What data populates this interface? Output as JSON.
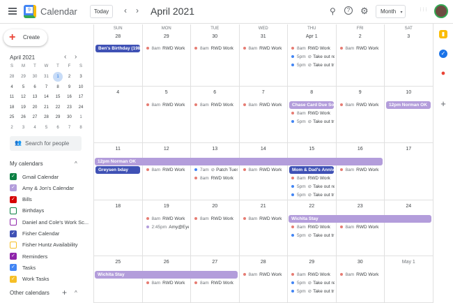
{
  "header": {
    "app_title": "Calendar",
    "logo_day": "9",
    "today": "Today",
    "prev": "‹",
    "next": "›",
    "month_title": "April 2021",
    "view": "Month",
    "view_caret": "▾",
    "search_icon": "⚲",
    "help_icon": "?",
    "settings_icon": "⚙",
    "apps_icon": "⋮⋮⋮"
  },
  "sidebar": {
    "create": "Create",
    "mini": {
      "title": "April 2021",
      "prev": "‹",
      "next": "›",
      "weekdays": [
        "S",
        "M",
        "T",
        "W",
        "T",
        "F",
        "S"
      ],
      "days": [
        "28",
        "29",
        "30",
        "31",
        "1",
        "2",
        "3",
        "4",
        "5",
        "6",
        "7",
        "8",
        "9",
        "10",
        "11",
        "12",
        "13",
        "14",
        "15",
        "16",
        "17",
        "18",
        "19",
        "20",
        "21",
        "22",
        "23",
        "24",
        "25",
        "26",
        "27",
        "28",
        "29",
        "30",
        "1",
        "2",
        "3",
        "4",
        "5",
        "6",
        "7",
        "8"
      ],
      "muted": [
        0,
        1,
        2,
        3,
        34,
        35,
        36,
        37,
        38,
        39,
        40,
        41
      ],
      "selected": 4
    },
    "search_placeholder": "Search for people",
    "my_calendars_label": "My calendars",
    "collapse": "^",
    "calendars": [
      {
        "name": "Gmail Calendar",
        "color": "#0b8043",
        "checked": true
      },
      {
        "name": "Amy & Jon's Calendar",
        "color": "#b39ddb",
        "checked": true
      },
      {
        "name": "Bills",
        "color": "#d50000",
        "checked": true
      },
      {
        "name": "Birthdays",
        "color": "#0b8043",
        "checked": false
      },
      {
        "name": "Daniel and Cole's Work Sc...",
        "color": "#8e24aa",
        "checked": false
      },
      {
        "name": "Fisher Calendar",
        "color": "#3f51b5",
        "checked": true
      },
      {
        "name": "Fisher Huntz Availability",
        "color": "#f6bf26",
        "checked": false
      },
      {
        "name": "Reminders",
        "color": "#8e24aa",
        "checked": true
      },
      {
        "name": "Tasks",
        "color": "#4285f4",
        "checked": true
      },
      {
        "name": "Work Tasks",
        "color": "#f6bf26",
        "checked": true
      }
    ],
    "other_calendars_label": "Other calendars",
    "add": "+"
  },
  "colors": {
    "rwd": "#e67c73",
    "task": "#4285f4",
    "dark": "#3f51b5",
    "lav": "#b39ddb",
    "amy": "#b39ddb"
  },
  "weekdays": [
    "SUN",
    "MON",
    "TUE",
    "WED",
    "THU",
    "FRI",
    "SAT"
  ],
  "weeks": [
    {
      "days": [
        {
          "n": "28",
          "ev": [
            {
              "chip": "dark",
              "title": "Ben's Birthday (1981"
            }
          ]
        },
        {
          "n": "29",
          "ev": [
            {
              "dot": "rwd",
              "time": "8am",
              "title": "RWD Work"
            }
          ]
        },
        {
          "n": "30",
          "ev": [
            {
              "dot": "rwd",
              "time": "8am",
              "title": "RWD Work"
            }
          ]
        },
        {
          "n": "31",
          "ev": [
            {
              "dot": "rwd",
              "time": "8am",
              "title": "RWD Work"
            }
          ]
        },
        {
          "n": "Apr 1",
          "ev": [
            {
              "dot": "rwd",
              "time": "8am",
              "title": "RWD Work"
            },
            {
              "dot": "task",
              "time": "5pm",
              "task": true,
              "title": "Take out re"
            },
            {
              "dot": "task",
              "time": "5pm",
              "task": true,
              "title": "Take out tr"
            }
          ]
        },
        {
          "n": "2",
          "ev": [
            {
              "dot": "rwd",
              "time": "8am",
              "title": "RWD Work"
            }
          ]
        },
        {
          "n": "3",
          "ev": []
        }
      ],
      "spans": []
    },
    {
      "days": [
        {
          "n": "4",
          "ev": []
        },
        {
          "n": "5",
          "ev": [
            {
              "dot": "rwd",
              "time": "8am",
              "title": "RWD Work"
            }
          ]
        },
        {
          "n": "6",
          "ev": [
            {
              "dot": "rwd",
              "time": "8am",
              "title": "RWD Work"
            }
          ]
        },
        {
          "n": "7",
          "ev": [
            {
              "dot": "rwd",
              "time": "8am",
              "title": "RWD Work"
            }
          ]
        },
        {
          "n": "8",
          "ev": [
            {
              "chip": "lav",
              "title": "Chase Card Due Soo"
            },
            {
              "dot": "rwd",
              "time": "8am",
              "title": "RWD Work"
            },
            {
              "dot": "task",
              "time": "5pm",
              "task": true,
              "title": "Take out tr"
            }
          ]
        },
        {
          "n": "9",
          "ev": [
            {
              "dot": "rwd",
              "time": "8am",
              "title": "RWD Work"
            }
          ]
        },
        {
          "n": "10",
          "ev": [
            {
              "chip": "lav",
              "title": "12pm Norman OK"
            }
          ]
        }
      ],
      "spans": []
    },
    {
      "days": [
        {
          "n": "11",
          "ev": [
            {
              "chip": "dark",
              "title": "Greysen bday"
            }
          ]
        },
        {
          "n": "12",
          "ev": [
            {
              "dot": "rwd",
              "time": "8am",
              "title": "RWD Work"
            }
          ]
        },
        {
          "n": "13",
          "ev": [
            {
              "dot": "task",
              "time": "7am",
              "task": true,
              "title": "Patch Tues"
            },
            {
              "dot": "rwd",
              "time": "8am",
              "title": "RWD Work"
            }
          ]
        },
        {
          "n": "14",
          "ev": [
            {
              "dot": "rwd",
              "time": "8am",
              "title": "RWD Work"
            }
          ]
        },
        {
          "n": "15",
          "ev": [
            {
              "chip": "dark",
              "title": "Mom & Dad's Annive"
            },
            {
              "dot": "rwd",
              "time": "8am",
              "title": "RWD Work"
            },
            {
              "dot": "task",
              "time": "5pm",
              "task": true,
              "title": "Take out re"
            },
            {
              "dot": "task",
              "time": "5pm",
              "task": true,
              "title": "Take out tr"
            }
          ]
        },
        {
          "n": "16",
          "ev": [
            {
              "dot": "rwd",
              "time": "8am",
              "title": "RWD Work"
            }
          ]
        },
        {
          "n": "17",
          "ev": []
        }
      ],
      "spans": [
        {
          "title": "12pm Norman OK",
          "color": "lav",
          "from": 0,
          "to": 5
        }
      ]
    },
    {
      "days": [
        {
          "n": "18",
          "ev": []
        },
        {
          "n": "19",
          "ev": [
            {
              "dot": "rwd",
              "time": "8am",
              "title": "RWD Work"
            },
            {
              "dot": "amy",
              "time": "2:45pm",
              "title": "Amy@EyeD"
            }
          ]
        },
        {
          "n": "20",
          "ev": [
            {
              "dot": "rwd",
              "time": "8am",
              "title": "RWD Work"
            }
          ]
        },
        {
          "n": "21",
          "ev": [
            {
              "dot": "rwd",
              "time": "8am",
              "title": "RWD Work"
            }
          ]
        },
        {
          "n": "22",
          "ev": [
            {
              "dot": "rwd",
              "time": "8am",
              "title": "RWD Work"
            },
            {
              "dot": "task",
              "time": "5pm",
              "task": true,
              "title": "Take out tr"
            }
          ]
        },
        {
          "n": "23",
          "ev": [
            {
              "dot": "rwd",
              "time": "8am",
              "title": "RWD Work"
            }
          ]
        },
        {
          "n": "24",
          "ev": []
        }
      ],
      "spans": [
        {
          "title": "Wichita Stay",
          "color": "lav",
          "from": 4,
          "to": 6
        }
      ]
    },
    {
      "days": [
        {
          "n": "25",
          "ev": []
        },
        {
          "n": "26",
          "ev": [
            {
              "dot": "rwd",
              "time": "8am",
              "title": "RWD Work"
            }
          ]
        },
        {
          "n": "27",
          "ev": [
            {
              "dot": "rwd",
              "time": "8am",
              "title": "RWD Work"
            }
          ]
        },
        {
          "n": "28",
          "ev": [
            {
              "dot": "rwd",
              "time": "8am",
              "title": "RWD Work"
            }
          ]
        },
        {
          "n": "29",
          "ev": [
            {
              "dot": "rwd",
              "time": "8am",
              "title": "RWD Work"
            },
            {
              "dot": "task",
              "time": "5pm",
              "task": true,
              "title": "Take out re"
            },
            {
              "dot": "task",
              "time": "5pm",
              "task": true,
              "title": "Take out tr"
            }
          ]
        },
        {
          "n": "30",
          "ev": [
            {
              "dot": "rwd",
              "time": "8am",
              "title": "RWD Work"
            }
          ]
        },
        {
          "n": "May 1",
          "muted": true,
          "ev": []
        }
      ],
      "spans": [
        {
          "title": "Wichita Stay",
          "color": "lav",
          "from": 0,
          "to": 2
        }
      ]
    }
  ],
  "side_panel": {
    "keep_icon": "▮",
    "tasks_icon": "✓",
    "maps_icon": "●",
    "add": "+"
  }
}
